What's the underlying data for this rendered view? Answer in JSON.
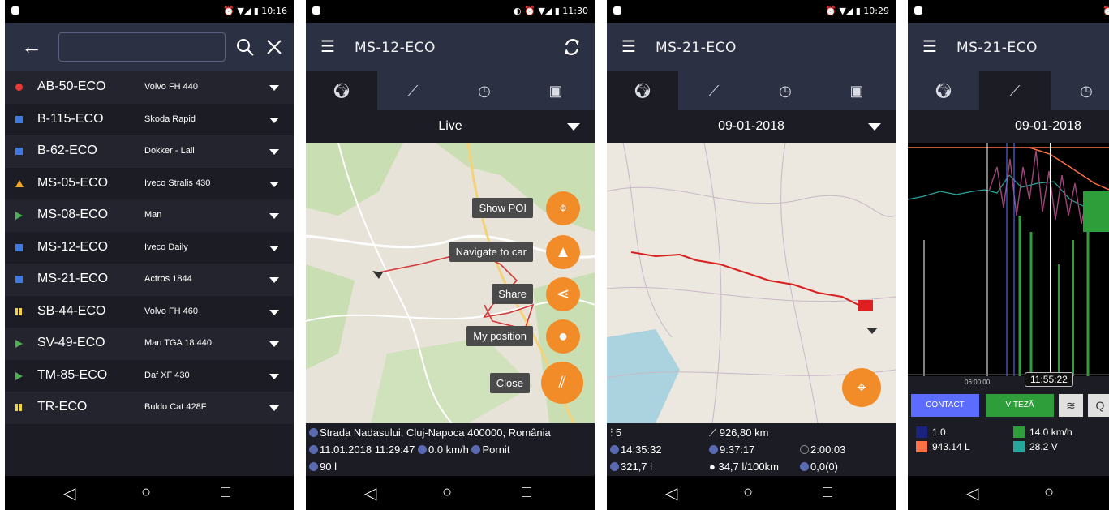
{
  "status": {
    "s1_time": "10:16",
    "s2_time": "11:30",
    "s3_time": "10:29"
  },
  "list_screen": {
    "vehicles": [
      {
        "name": "AB-50-ECO",
        "model": "Volvo FH 440",
        "marker_color": "#e53935",
        "marker": "circle"
      },
      {
        "name": "B-115-ECO",
        "model": "Skoda Rapid",
        "marker_color": "#3f7ae0",
        "marker": "square"
      },
      {
        "name": "B-62-ECO",
        "model": "Dokker - Lali",
        "marker_color": "#3f7ae0",
        "marker": "square"
      },
      {
        "name": "MS-05-ECO",
        "model": "Iveco Stralis 430",
        "marker_color": "#f5a623",
        "marker": "triangle"
      },
      {
        "name": "MS-08-ECO",
        "model": "Man",
        "marker_color": "#4caf50",
        "marker": "arrow"
      },
      {
        "name": "MS-12-ECO",
        "model": "Iveco Daily",
        "marker_color": "#3f7ae0",
        "marker": "square"
      },
      {
        "name": "MS-21-ECO",
        "model": "Actros 1844",
        "marker_color": "#3f7ae0",
        "marker": "square"
      },
      {
        "name": "SB-44-ECO",
        "model": "Volvo FH 460",
        "marker_color": "#f5d33a",
        "marker": "pause"
      },
      {
        "name": "SV-49-ECO",
        "model": "Man TGA 18.440",
        "marker_color": "#4caf50",
        "marker": "arrow"
      },
      {
        "name": "TM-85-ECO",
        "model": "Daf XF 430",
        "marker_color": "#4caf50",
        "marker": "arrow"
      },
      {
        "name": "TR-ECO",
        "model": "Buldo Cat 428F",
        "marker_color": "#f5d33a",
        "marker": "pause"
      }
    ]
  },
  "live_screen": {
    "title": "MS-12-ECO",
    "period": "Live",
    "menu": {
      "show_poi": "Show POI",
      "navigate": "Navigate to car",
      "share": "Share",
      "my_position": "My position",
      "close": "Close"
    },
    "address": "Strada Nadasului, Cluj-Napoca 400000, România",
    "datetime": "11.01.2018 11:29:47",
    "speed": "0.0 km/h",
    "engine": "Pornit",
    "fuel": "90 l"
  },
  "history_screen": {
    "title": "MS-21-ECO",
    "date": "09-01-2018",
    "stops": "5",
    "distance": "926,80 km",
    "time1": "14:35:32",
    "time2": "9:37:17",
    "time3": "2:00:03",
    "fuel_used": "321,7 l",
    "consumption": "34,7 l/100km",
    "extra": "0,0(0)"
  },
  "chart_screen": {
    "title": "MS-21-ECO",
    "date": "09-01-2018",
    "axis_start": "06:00:00",
    "cursor_time": "11:55:22",
    "btn_contact": "CONTACT",
    "btn_viteza": "VITEZĂ",
    "legend": [
      {
        "color": "#1a237e",
        "value": "1.0"
      },
      {
        "color": "#ff7043",
        "value": "943.14 L"
      },
      {
        "color": "#2e9e3a",
        "value": "14.0 km/h"
      },
      {
        "color": "#26a69a",
        "value": "28.2 V"
      }
    ]
  }
}
